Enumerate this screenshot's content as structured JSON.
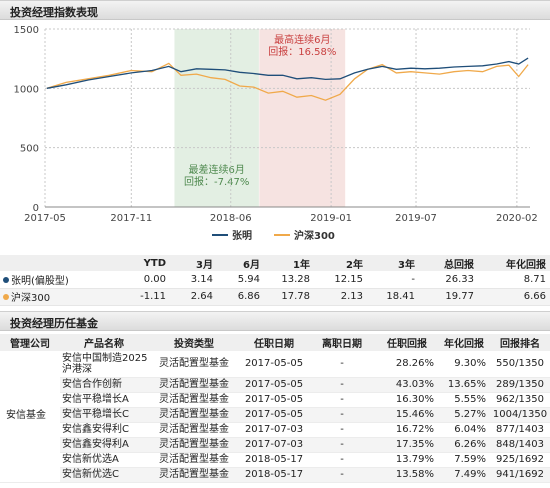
{
  "perf_section": {
    "title": "投资经理指数表现"
  },
  "chart_data": {
    "type": "line",
    "title": "",
    "xlabel": "",
    "ylabel": "",
    "x_range": [
      "2017-05-01",
      "2020-02-29"
    ],
    "ylim": [
      0,
      1500
    ],
    "y_ticks": [
      "0",
      "500",
      "1000",
      "1500"
    ],
    "x_ticks": [
      {
        "label": "2017-05",
        "date": "2017-05-01"
      },
      {
        "label": "2017-11",
        "date": "2017-11-01"
      },
      {
        "label": "2018-06",
        "date": "2018-06-01"
      },
      {
        "label": "2019-01",
        "date": "2019-01-01"
      },
      {
        "label": "2019-07",
        "date": "2019-07-01"
      },
      {
        "label": "2020-02",
        "date": "2020-02-01"
      }
    ],
    "series": [
      {
        "name": "张明",
        "color": "#1f4e79",
        "points": [
          [
            "2017-05-05",
            1000
          ],
          [
            "2017-06-15",
            1030
          ],
          [
            "2017-08-01",
            1070
          ],
          [
            "2017-09-15",
            1100
          ],
          [
            "2017-11-01",
            1130
          ],
          [
            "2017-12-15",
            1150
          ],
          [
            "2018-01-20",
            1185
          ],
          [
            "2018-02-15",
            1140
          ],
          [
            "2018-03-20",
            1165
          ],
          [
            "2018-04-20",
            1160
          ],
          [
            "2018-05-20",
            1155
          ],
          [
            "2018-06-20",
            1135
          ],
          [
            "2018-07-20",
            1125
          ],
          [
            "2018-08-20",
            1110
          ],
          [
            "2018-09-20",
            1110
          ],
          [
            "2018-10-20",
            1080
          ],
          [
            "2018-11-20",
            1090
          ],
          [
            "2018-12-20",
            1075
          ],
          [
            "2019-01-20",
            1080
          ],
          [
            "2019-02-20",
            1130
          ],
          [
            "2019-03-20",
            1160
          ],
          [
            "2019-04-20",
            1185
          ],
          [
            "2019-05-20",
            1160
          ],
          [
            "2019-06-20",
            1170
          ],
          [
            "2019-07-20",
            1165
          ],
          [
            "2019-08-20",
            1170
          ],
          [
            "2019-09-20",
            1180
          ],
          [
            "2019-10-20",
            1185
          ],
          [
            "2019-11-20",
            1190
          ],
          [
            "2019-12-20",
            1205
          ],
          [
            "2020-01-15",
            1225
          ],
          [
            "2020-02-05",
            1205
          ],
          [
            "2020-02-25",
            1255
          ]
        ]
      },
      {
        "name": "沪深300",
        "color": "#f0a94a",
        "points": [
          [
            "2017-05-05",
            1000
          ],
          [
            "2017-06-15",
            1050
          ],
          [
            "2017-08-01",
            1080
          ],
          [
            "2017-09-15",
            1110
          ],
          [
            "2017-11-01",
            1150
          ],
          [
            "2017-12-15",
            1140
          ],
          [
            "2018-01-20",
            1210
          ],
          [
            "2018-02-15",
            1110
          ],
          [
            "2018-03-20",
            1120
          ],
          [
            "2018-04-20",
            1090
          ],
          [
            "2018-05-20",
            1075
          ],
          [
            "2018-06-20",
            1020
          ],
          [
            "2018-07-20",
            1010
          ],
          [
            "2018-08-20",
            960
          ],
          [
            "2018-09-20",
            975
          ],
          [
            "2018-10-20",
            925
          ],
          [
            "2018-11-20",
            940
          ],
          [
            "2018-12-20",
            900
          ],
          [
            "2019-01-20",
            950
          ],
          [
            "2019-02-20",
            1080
          ],
          [
            "2019-03-20",
            1160
          ],
          [
            "2019-04-20",
            1200
          ],
          [
            "2019-05-20",
            1130
          ],
          [
            "2019-06-20",
            1140
          ],
          [
            "2019-07-20",
            1130
          ],
          [
            "2019-08-20",
            1120
          ],
          [
            "2019-09-20",
            1140
          ],
          [
            "2019-10-20",
            1150
          ],
          [
            "2019-11-20",
            1140
          ],
          [
            "2019-12-20",
            1185
          ],
          [
            "2020-01-15",
            1195
          ],
          [
            "2020-02-05",
            1100
          ],
          [
            "2020-02-25",
            1200
          ]
        ]
      }
    ],
    "bands": [
      {
        "start": "2018-02-01",
        "end": "2018-07-31",
        "color": "#e3efe3",
        "label_line1": "最差连续6月",
        "label_line2": "回报：-7.47%",
        "label_color": "#4f8a4f",
        "label_position": "lower"
      },
      {
        "start": "2018-08-01",
        "end": "2019-01-31",
        "color": "#f6e3e1",
        "label_line1": "最高连续6月",
        "label_line2": "回报：16.58%",
        "label_color": "#c94040",
        "label_position": "upper"
      }
    ],
    "legend_position": "bottom-center",
    "grid": true
  },
  "perf_table": {
    "headers": [
      "YTD",
      "3月",
      "6月",
      "1年",
      "2年",
      "3年",
      "总回报",
      "年化回报"
    ],
    "rows": [
      {
        "name": "张明(偏股型)",
        "dot": "#1f4e79",
        "values": [
          "0.00",
          "3.14",
          "5.94",
          "13.28",
          "12.15",
          "-",
          "26.33",
          "8.71"
        ]
      },
      {
        "name": "沪深300",
        "dot": "#f0a94a",
        "values": [
          "-1.11",
          "2.64",
          "6.86",
          "17.78",
          "2.13",
          "18.41",
          "19.77",
          "6.66"
        ]
      }
    ]
  },
  "fund_section": {
    "title": "投资经理历任基金"
  },
  "fund_table": {
    "headers": [
      "管理公司",
      "产品名称",
      "投资类型",
      "任职日期",
      "离职日期",
      "任职回报",
      "年化回报",
      "回报排名"
    ],
    "company": "安信基金",
    "rows": [
      {
        "name": "安信中国制造2025沪港深",
        "type": "灵活配置型基金",
        "start": "2017-05-05",
        "end": "-",
        "ret": "28.26%",
        "ann": "9.30%",
        "rank": "550/1350"
      },
      {
        "name": "安信合作创新",
        "type": "灵活配置型基金",
        "start": "2017-05-05",
        "end": "-",
        "ret": "43.03%",
        "ann": "13.65%",
        "rank": "289/1350"
      },
      {
        "name": "安信平稳增长A",
        "type": "灵活配置型基金",
        "start": "2017-05-05",
        "end": "-",
        "ret": "16.30%",
        "ann": "5.55%",
        "rank": "962/1350"
      },
      {
        "name": "安信平稳增长C",
        "type": "灵活配置型基金",
        "start": "2017-05-05",
        "end": "-",
        "ret": "15.46%",
        "ann": "5.27%",
        "rank": "1004/1350"
      },
      {
        "name": "安信鑫安得利C",
        "type": "灵活配置型基金",
        "start": "2017-07-03",
        "end": "-",
        "ret": "16.72%",
        "ann": "6.04%",
        "rank": "877/1403"
      },
      {
        "name": "安信鑫安得利A",
        "type": "灵活配置型基金",
        "start": "2017-07-03",
        "end": "-",
        "ret": "17.35%",
        "ann": "6.26%",
        "rank": "848/1403"
      },
      {
        "name": "安信新优选A",
        "type": "灵活配置型基金",
        "start": "2018-05-17",
        "end": "-",
        "ret": "13.79%",
        "ann": "7.59%",
        "rank": "925/1692"
      },
      {
        "name": "安信新优选C",
        "type": "灵活配置型基金",
        "start": "2018-05-17",
        "end": "-",
        "ret": "13.58%",
        "ann": "7.49%",
        "rank": "941/1692"
      }
    ]
  }
}
